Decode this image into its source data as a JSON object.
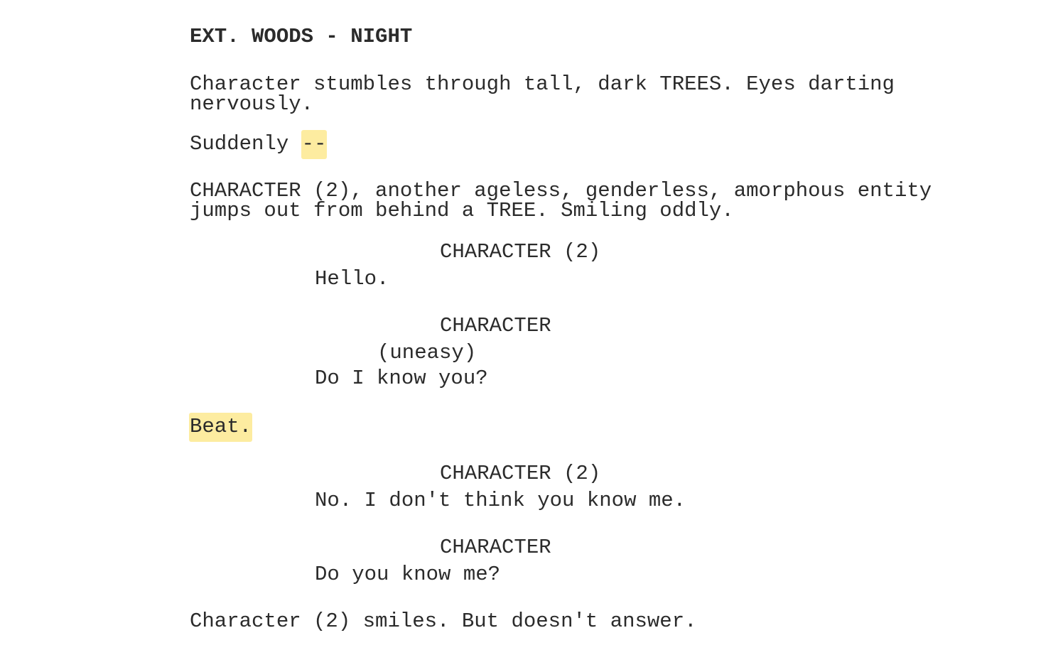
{
  "screenplay": {
    "scene_heading": "EXT. WOODS - NIGHT",
    "action_1_line_1": "Character stumbles through tall, dark TREES. Eyes darting",
    "action_1_line_2": "nervously.",
    "action_2_text": "Suddenly ",
    "action_2_highlight": "--",
    "action_3_line_1": "CHARACTER (2), another ageless, genderless, amorphous entity",
    "action_3_line_2": "jumps out from behind a TREE. Smiling oddly.",
    "character_1": "CHARACTER (2)",
    "dialogue_1": "Hello.",
    "character_2": "CHARACTER",
    "parenthetical_2": "(uneasy)",
    "dialogue_2": "Do I know you?",
    "action_4_highlight": "Beat.",
    "character_3": "CHARACTER (2)",
    "dialogue_3": "No. I don't think you know me.",
    "character_4": "CHARACTER",
    "dialogue_4": "Do you know me?",
    "action_5": "Character (2) smiles. But doesn't answer."
  },
  "colors": {
    "text": "#2b2b2b",
    "highlight": "#fdeca0",
    "background": "#ffffff"
  }
}
